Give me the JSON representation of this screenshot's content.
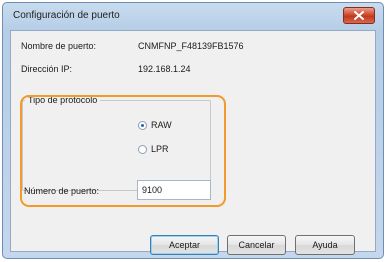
{
  "window": {
    "title": "Configuración de puerto"
  },
  "fields": {
    "port_name_label": "Nombre de puerto:",
    "port_name_value": "CNMFNP_F48139FB1576",
    "ip_label": "Dirección IP:",
    "ip_value": "192.168.1.24"
  },
  "protocol": {
    "legend": "Tipo de protocolo",
    "options": [
      {
        "label": "RAW",
        "selected": true
      },
      {
        "label": "LPR",
        "selected": false
      }
    ]
  },
  "port_number": {
    "label": "Número de puerto:",
    "value": "9100"
  },
  "buttons": {
    "accept": "Aceptar",
    "cancel": "Cancelar",
    "help": "Ayuda"
  },
  "colors": {
    "highlight": "#f29b2a",
    "close_button": "#c0391f"
  },
  "icons": {
    "close": "close-icon"
  }
}
